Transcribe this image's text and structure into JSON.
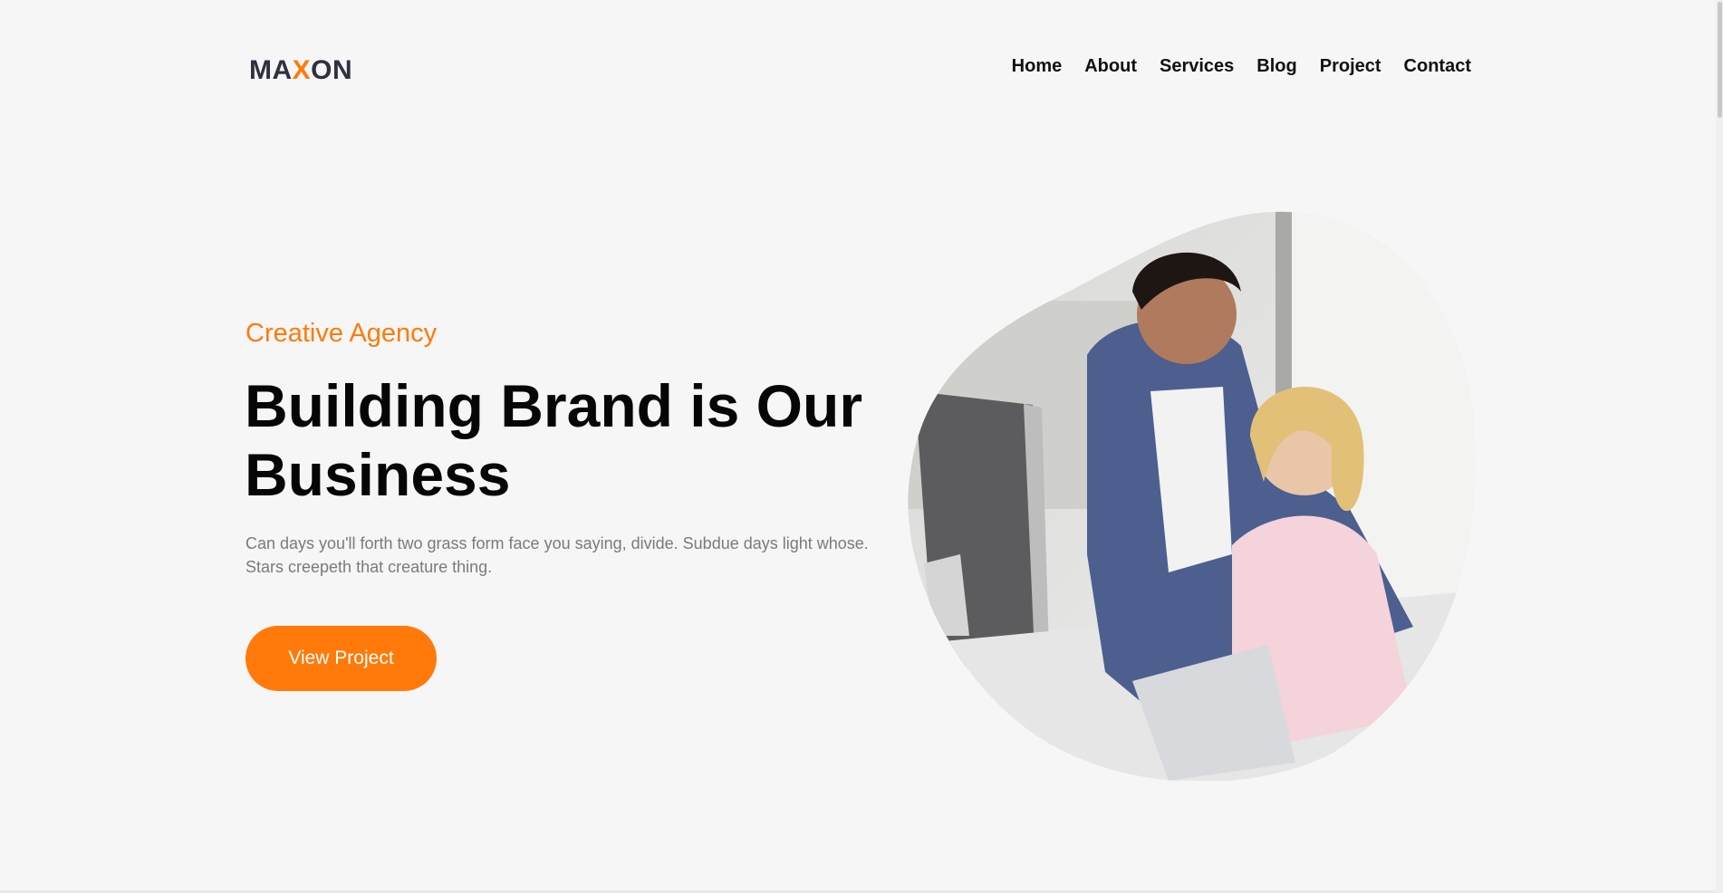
{
  "brand": {
    "part1": "MA",
    "part2": "X",
    "part3": "ON"
  },
  "nav": [
    "Home",
    "About",
    "Services",
    "Blog",
    "Project",
    "Contact"
  ],
  "hero": {
    "eyebrow": "Creative Agency",
    "headline_line1": "Building Brand is Our",
    "headline_line2": "Business",
    "body_line1": "Can days you'll forth two grass form face you saying, divide. Subdue days light whose.",
    "body_line2": "Stars creepeth that creature thing.",
    "cta_label": "View Project"
  },
  "image": {
    "alt": "two people smiling at a computer"
  },
  "colors": {
    "accent": "#ff7a0a",
    "background": "#f6f6f6",
    "text": "#060606",
    "muted": "#7a7a7a"
  }
}
